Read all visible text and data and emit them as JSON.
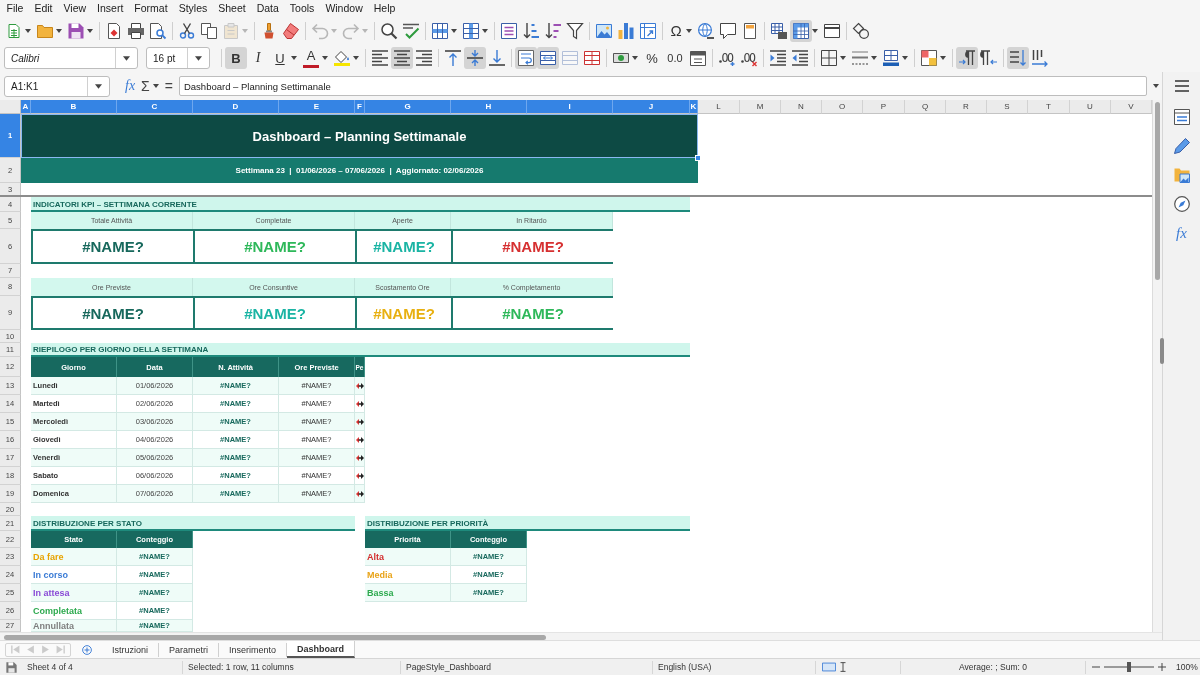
{
  "menu_bar": {
    "items": [
      "File",
      "Edit",
      "View",
      "Insert",
      "Format",
      "Styles",
      "Sheet",
      "Data",
      "Tools",
      "Window",
      "Help"
    ]
  },
  "standard_toolbar": {
    "paste_enabled": false,
    "undo_enabled": false,
    "redo_enabled": false,
    "special_character_label": "Ω",
    "freeze_panes": true
  },
  "formatting_toolbar": {
    "font_name": "Calibri",
    "font_size": "16 pt",
    "bold_label": "B",
    "bold": true,
    "italic_label": "I",
    "italic": false,
    "underline_label": "U",
    "underline": false,
    "font_color_label": "A",
    "align_left": false,
    "align_center": true,
    "align_right": false,
    "align_top": false,
    "align_middle": true,
    "align_bottom": false,
    "wrap_text": true,
    "merge_and_center": true,
    "merge_cells_enabled": false,
    "percent_label": "%",
    "decimal_label": "0.0",
    "left_to_right": true,
    "right_to_left": false,
    "text_horizontal": true,
    "text_vertical": false
  },
  "formula_bar": {
    "name_box": "A1:K1",
    "function_wizard_label": "fx",
    "sum_label": "Σ",
    "formula_label": "=",
    "content": "Dashboard – Planning Settimanale"
  },
  "sheet": {
    "columns": [
      {
        "label": "A",
        "selected": true
      },
      {
        "label": "B",
        "selected": true
      },
      {
        "label": "C",
        "selected": true
      },
      {
        "label": "D",
        "selected": true
      },
      {
        "label": "E",
        "selected": true
      },
      {
        "label": "F",
        "selected": true
      },
      {
        "label": "G",
        "selected": true
      },
      {
        "label": "H",
        "selected": true
      },
      {
        "label": "I",
        "selected": true
      },
      {
        "label": "J",
        "selected": true
      },
      {
        "label": "K",
        "selected": true
      },
      {
        "label": "L",
        "selected": false
      },
      {
        "label": "M",
        "selected": false
      },
      {
        "label": "N",
        "selected": false
      },
      {
        "label": "O",
        "selected": false
      },
      {
        "label": "P",
        "selected": false
      },
      {
        "label": "Q",
        "selected": false
      },
      {
        "label": "R",
        "selected": false
      },
      {
        "label": "S",
        "selected": false
      },
      {
        "label": "T",
        "selected": false
      },
      {
        "label": "U",
        "selected": false
      },
      {
        "label": "V",
        "selected": false
      }
    ],
    "rows": [
      {
        "label": "1",
        "selected": true
      },
      {
        "label": "2",
        "selected": false
      },
      {
        "label": "3",
        "selected": false
      },
      {
        "label": "4",
        "selected": false
      },
      {
        "label": "5",
        "selected": false
      },
      {
        "label": "6",
        "selected": false
      },
      {
        "label": "7",
        "selected": false
      },
      {
        "label": "8",
        "selected": false
      },
      {
        "label": "9",
        "selected": false
      },
      {
        "label": "10",
        "selected": false
      },
      {
        "label": "11",
        "selected": false
      },
      {
        "label": "12",
        "selected": false
      },
      {
        "label": "13",
        "selected": false
      },
      {
        "label": "14",
        "selected": false
      },
      {
        "label": "15",
        "selected": false
      },
      {
        "label": "16",
        "selected": false
      },
      {
        "label": "17",
        "selected": false
      },
      {
        "label": "18",
        "selected": false
      },
      {
        "label": "19",
        "selected": false
      },
      {
        "label": "20",
        "selected": false
      },
      {
        "label": "21",
        "selected": false
      },
      {
        "label": "22",
        "selected": false
      },
      {
        "label": "23",
        "selected": false
      },
      {
        "label": "24",
        "selected": false
      },
      {
        "label": "25",
        "selected": false
      },
      {
        "label": "26",
        "selected": false
      },
      {
        "label": "27",
        "selected": false
      }
    ],
    "title": {
      "text": "Dashboard – Planning Settimanale",
      "selected": true
    },
    "subtitle": "Settimana 23  |  01/06/2026 – 07/06/2026  |  Aggiornato: 02/06/2026",
    "kpi": {
      "heading": "INDICATORI KPI – SETTIMANA CORRENTE",
      "card_rows": [
        [
          {
            "label": "Totale Attività",
            "value": "#NAME?",
            "color": "#17685c"
          },
          {
            "label": "Completate",
            "value": "#NAME?",
            "color": "#2eb85a"
          },
          {
            "label": "Aperte",
            "value": "#NAME?",
            "color": "#1ab4a4"
          },
          {
            "label": "In Ritardo",
            "value": "#NAME?",
            "color": "#d63031"
          }
        ],
        [
          {
            "label": "Ore Previste",
            "value": "#NAME?",
            "color": "#17685c"
          },
          {
            "label": "Ore Consuntive",
            "value": "#NAME?",
            "color": "#1ab4a4"
          },
          {
            "label": "Scostamento Ore",
            "value": "#NAME?",
            "color": "#e8b010"
          },
          {
            "label": "% Completamento",
            "value": "#NAME?",
            "color": "#2eb85a"
          }
        ]
      ]
    },
    "daily_summary": {
      "heading": "RIEPILOGO PER GIORNO DELLA SETTIMANA",
      "columns": [
        "Giorno",
        "Data",
        "N. Attività",
        "Ore Previste",
        "Pe"
      ],
      "rows": [
        {
          "day": "Lunedì",
          "date": "01/06/2026",
          "activities": "#NAME?",
          "planned_hours": "#NAME?",
          "column_5_overflow": true
        },
        {
          "day": "Martedì",
          "date": "02/06/2026",
          "activities": "#NAME?",
          "planned_hours": "#NAME?",
          "column_5_overflow": true
        },
        {
          "day": "Mercoledì",
          "date": "03/06/2026",
          "activities": "#NAME?",
          "planned_hours": "#NAME?",
          "column_5_overflow": true
        },
        {
          "day": "Giovedì",
          "date": "04/06/2026",
          "activities": "#NAME?",
          "planned_hours": "#NAME?",
          "column_5_overflow": true
        },
        {
          "day": "Venerdì",
          "date": "05/06/2026",
          "activities": "#NAME?",
          "planned_hours": "#NAME?",
          "column_5_overflow": true
        },
        {
          "day": "Sabato",
          "date": "06/06/2026",
          "activities": "#NAME?",
          "planned_hours": "#NAME?",
          "column_5_overflow": true
        },
        {
          "day": "Domenica",
          "date": "07/06/2026",
          "activities": "#NAME?",
          "planned_hours": "#NAME?",
          "column_5_overflow": true
        }
      ]
    },
    "status_distribution": {
      "heading": "DISTRIBUZIONE PER STATO",
      "columns": [
        "Stato",
        "Conteggio"
      ],
      "rows": [
        {
          "label": "Da fare",
          "color": "#e8a300",
          "count": "#NAME?"
        },
        {
          "label": "In corso",
          "color": "#3a7bd5",
          "count": "#NAME?"
        },
        {
          "label": "In attesa",
          "color": "#8a4bd6",
          "count": "#NAME?"
        },
        {
          "label": "Completata",
          "color": "#2eaa4f",
          "count": "#NAME?"
        },
        {
          "label": "Annullata",
          "color": "#7f7f7f",
          "count": "#NAME?"
        }
      ]
    },
    "priority_distribution": {
      "heading": "DISTRIBUZIONE PER PRIORITÀ",
      "columns": [
        "Priorità",
        "Conteggio"
      ],
      "rows": [
        {
          "label": "Alta",
          "color": "#d32f2f",
          "count": "#NAME?"
        },
        {
          "label": "Media",
          "color": "#e8a317",
          "count": "#NAME?"
        },
        {
          "label": "Bassa",
          "color": "#2eaa4f",
          "count": "#NAME?"
        }
      ]
    }
  },
  "sidebar": {
    "functions_label": "fx"
  },
  "sheet_tab_bar": {
    "scroll_buttons_enabled": false,
    "tabs": [
      {
        "label": "Istruzioni",
        "selected": false
      },
      {
        "label": "Parametri",
        "selected": false
      },
      {
        "label": "Inserimento",
        "selected": false
      },
      {
        "label": "Dashboard",
        "selected": true
      }
    ]
  },
  "status_bar": {
    "sheet_position": "Sheet 4 of 4",
    "selection": "Selected: 1 row, 11 columns",
    "page_style": "PageStyle_Dashboard",
    "language": "English (USA)",
    "statistics": "Average: ; Sum: 0",
    "zoom": {
      "level": 0.5,
      "reading": "100%"
    }
  }
}
